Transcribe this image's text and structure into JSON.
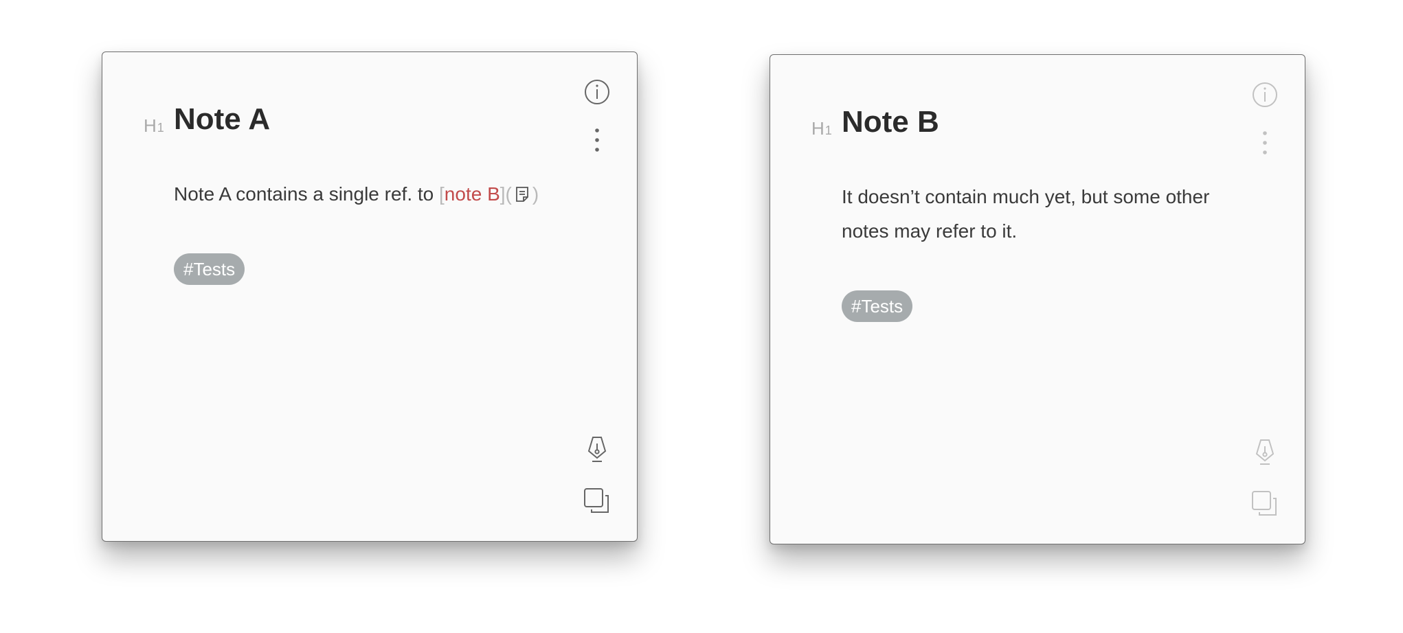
{
  "notes": [
    {
      "heading_marker": "H",
      "heading_level": "1",
      "title": "Note A",
      "body_text": "Note A contains a single ref. to ",
      "link": {
        "open_bracket": "[",
        "text": "note B",
        "close_bracket": "]",
        "open_paren": "(",
        "icon": "note-icon",
        "close_paren": ")"
      },
      "tag": "#Tests",
      "active": true
    },
    {
      "heading_marker": "H",
      "heading_level": "1",
      "title": "Note B",
      "body_text": "It doesn’t contain much yet, but some other notes may refer to it.",
      "tag": "#Tests",
      "active": false
    }
  ],
  "icons": {
    "info": "info-circle-icon",
    "more": "vertical-ellipsis-icon",
    "edit": "fountain-pen-icon",
    "duplicate": "copy-icon"
  },
  "colors": {
    "link": "#c24b4b",
    "tag_bg": "#a6abad",
    "window_bg": "#fafafa"
  }
}
